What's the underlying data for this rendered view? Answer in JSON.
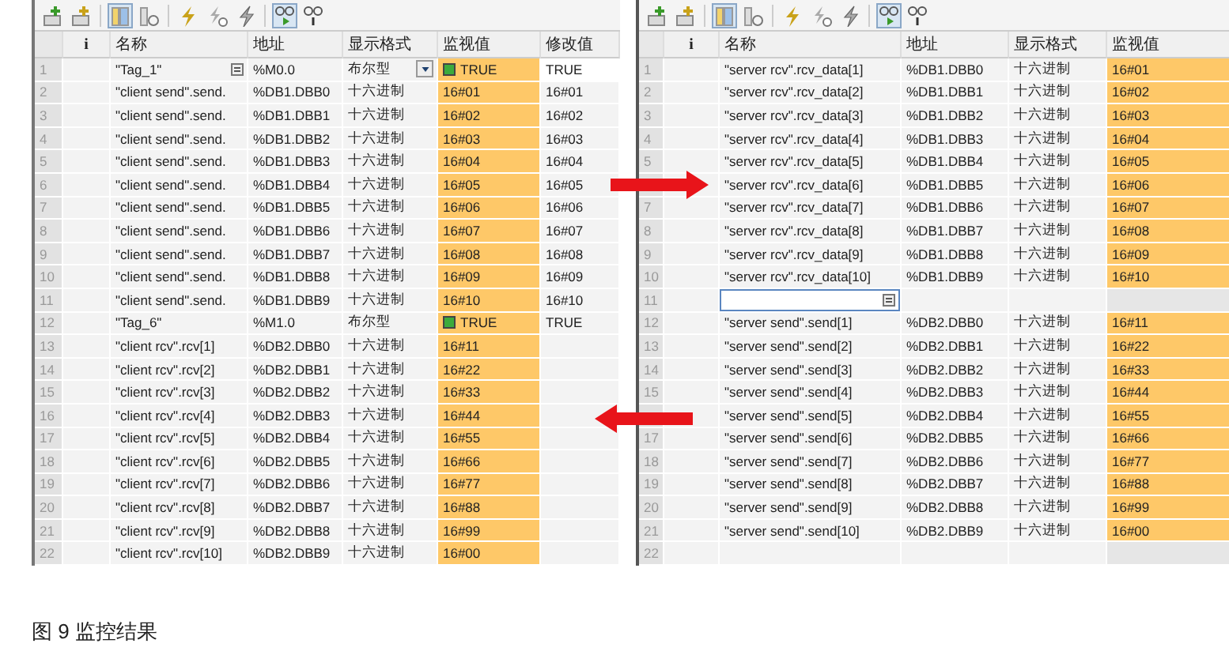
{
  "panels": [
    {
      "toolbar": [
        {
          "kind": "insert-row",
          "selected": false
        },
        {
          "kind": "add-row",
          "selected": false
        },
        {
          "kind": "columns",
          "selected": true
        },
        {
          "kind": "column-toggle",
          "selected": false
        },
        {
          "kind": "force",
          "selected": false
        },
        {
          "kind": "force-timer",
          "selected": false
        },
        {
          "kind": "force-all",
          "selected": false
        },
        {
          "kind": "monitor",
          "selected": true
        },
        {
          "kind": "monitor-once",
          "selected": false
        }
      ],
      "columns": [
        "i",
        "名称",
        "地址",
        "显示格式",
        "监视值",
        "修改值"
      ],
      "rows": [
        {
          "number": "1",
          "kind": "bool",
          "editing": true,
          "name": "\"Tag_1\"",
          "address": "%M0.0",
          "format": "布尔型",
          "monitor": "TRUE",
          "modify": "TRUE"
        },
        {
          "number": "2",
          "kind": "hex",
          "editing": false,
          "name": "\"client send\".send.",
          "address": "%DB1.DBB0",
          "format": "十六进制",
          "monitor": "16#01",
          "modify": "16#01"
        },
        {
          "number": "3",
          "kind": "hex",
          "editing": false,
          "name": "\"client send\".send.",
          "address": "%DB1.DBB1",
          "format": "十六进制",
          "monitor": "16#02",
          "modify": "16#02"
        },
        {
          "number": "4",
          "kind": "hex",
          "editing": false,
          "name": "\"client send\".send.",
          "address": "%DB1.DBB2",
          "format": "十六进制",
          "monitor": "16#03",
          "modify": "16#03"
        },
        {
          "number": "5",
          "kind": "hex",
          "editing": false,
          "name": "\"client send\".send.",
          "address": "%DB1.DBB3",
          "format": "十六进制",
          "monitor": "16#04",
          "modify": "16#04"
        },
        {
          "number": "6",
          "kind": "hex",
          "editing": false,
          "name": "\"client send\".send.",
          "address": "%DB1.DBB4",
          "format": "十六进制",
          "monitor": "16#05",
          "modify": "16#05"
        },
        {
          "number": "7",
          "kind": "hex",
          "editing": false,
          "name": "\"client send\".send.",
          "address": "%DB1.DBB5",
          "format": "十六进制",
          "monitor": "16#06",
          "modify": "16#06"
        },
        {
          "number": "8",
          "kind": "hex",
          "editing": false,
          "name": "\"client send\".send.",
          "address": "%DB1.DBB6",
          "format": "十六进制",
          "monitor": "16#07",
          "modify": "16#07"
        },
        {
          "number": "9",
          "kind": "hex",
          "editing": false,
          "name": "\"client send\".send.",
          "address": "%DB1.DBB7",
          "format": "十六进制",
          "monitor": "16#08",
          "modify": "16#08"
        },
        {
          "number": "10",
          "kind": "hex",
          "editing": false,
          "name": "\"client send\".send.",
          "address": "%DB1.DBB8",
          "format": "十六进制",
          "monitor": "16#09",
          "modify": "16#09"
        },
        {
          "number": "11",
          "kind": "hex",
          "editing": false,
          "name": "\"client send\".send.",
          "address": "%DB1.DBB9",
          "format": "十六进制",
          "monitor": "16#10",
          "modify": "16#10"
        },
        {
          "number": "12",
          "kind": "bool",
          "editing": false,
          "name": "\"Tag_6\"",
          "address": "%M1.0",
          "format": "布尔型",
          "monitor": "TRUE",
          "modify": "TRUE"
        },
        {
          "number": "13",
          "kind": "hex",
          "editing": false,
          "name": "\"client rcv\".rcv[1]",
          "address": "%DB2.DBB0",
          "format": "十六进制",
          "monitor": "16#11"
        },
        {
          "number": "14",
          "kind": "hex",
          "editing": false,
          "name": "\"client rcv\".rcv[2]",
          "address": "%DB2.DBB1",
          "format": "十六进制",
          "monitor": "16#22"
        },
        {
          "number": "15",
          "kind": "hex",
          "editing": false,
          "name": "\"client rcv\".rcv[3]",
          "address": "%DB2.DBB2",
          "format": "十六进制",
          "monitor": "16#33"
        },
        {
          "number": "16",
          "kind": "hex",
          "editing": false,
          "name": "\"client rcv\".rcv[4]",
          "address": "%DB2.DBB3",
          "format": "十六进制",
          "monitor": "16#44"
        },
        {
          "number": "17",
          "kind": "hex",
          "editing": false,
          "name": "\"client rcv\".rcv[5]",
          "address": "%DB2.DBB4",
          "format": "十六进制",
          "monitor": "16#55"
        },
        {
          "number": "18",
          "kind": "hex",
          "editing": false,
          "name": "\"client rcv\".rcv[6]",
          "address": "%DB2.DBB5",
          "format": "十六进制",
          "monitor": "16#66"
        },
        {
          "number": "19",
          "kind": "hex",
          "editing": false,
          "name": "\"client rcv\".rcv[7]",
          "address": "%DB2.DBB6",
          "format": "十六进制",
          "monitor": "16#77"
        },
        {
          "number": "20",
          "kind": "hex",
          "editing": false,
          "name": "\"client rcv\".rcv[8]",
          "address": "%DB2.DBB7",
          "format": "十六进制",
          "monitor": "16#88"
        },
        {
          "number": "21",
          "kind": "hex",
          "editing": false,
          "name": "\"client rcv\".rcv[9]",
          "address": "%DB2.DBB8",
          "format": "十六进制",
          "monitor": "16#99"
        },
        {
          "number": "22",
          "kind": "hex",
          "editing": false,
          "name": "\"client rcv\".rcv[10]",
          "address": "%DB2.DBB9",
          "format": "十六进制",
          "monitor": "16#00"
        }
      ]
    },
    {
      "toolbar": [
        {
          "kind": "insert-row",
          "selected": false
        },
        {
          "kind": "add-row",
          "selected": false
        },
        {
          "kind": "columns",
          "selected": true
        },
        {
          "kind": "column-toggle",
          "selected": false
        },
        {
          "kind": "force",
          "selected": false
        },
        {
          "kind": "force-timer",
          "selected": false
        },
        {
          "kind": "force-all",
          "selected": false
        },
        {
          "kind": "monitor",
          "selected": true
        },
        {
          "kind": "monitor-once",
          "selected": false
        }
      ],
      "columns": [
        "i",
        "名称",
        "地址",
        "显示格式",
        "监视值"
      ],
      "rows": [
        {
          "number": "1",
          "kind": "hex",
          "editing": false,
          "name": "\"server rcv\".rcv_data[1]",
          "address": "%DB1.DBB0",
          "format": "十六进制",
          "monitor": "16#01"
        },
        {
          "number": "2",
          "kind": "hex",
          "editing": false,
          "name": "\"server rcv\".rcv_data[2]",
          "address": "%DB1.DBB1",
          "format": "十六进制",
          "monitor": "16#02"
        },
        {
          "number": "3",
          "kind": "hex",
          "editing": false,
          "name": "\"server rcv\".rcv_data[3]",
          "address": "%DB1.DBB2",
          "format": "十六进制",
          "monitor": "16#03"
        },
        {
          "number": "4",
          "kind": "hex",
          "editing": false,
          "name": "\"server rcv\".rcv_data[4]",
          "address": "%DB1.DBB3",
          "format": "十六进制",
          "monitor": "16#04"
        },
        {
          "number": "5",
          "kind": "hex",
          "editing": false,
          "name": "\"server rcv\".rcv_data[5]",
          "address": "%DB1.DBB4",
          "format": "十六进制",
          "monitor": "16#05"
        },
        {
          "kind": "hex",
          "editing": false,
          "name": "\"server rcv\".rcv_data[6]",
          "address": "%DB1.DBB5",
          "format": "十六进制",
          "monitor": "16#06"
        },
        {
          "number": "7",
          "kind": "hex",
          "editing": false,
          "name": "\"server rcv\".rcv_data[7]",
          "address": "%DB1.DBB6",
          "format": "十六进制",
          "monitor": "16#07"
        },
        {
          "number": "8",
          "kind": "hex",
          "editing": false,
          "name": "\"server rcv\".rcv_data[8]",
          "address": "%DB1.DBB7",
          "format": "十六进制",
          "monitor": "16#08"
        },
        {
          "number": "9",
          "kind": "hex",
          "editing": false,
          "name": "\"server rcv\".rcv_data[9]",
          "address": "%DB1.DBB8",
          "format": "十六进制",
          "monitor": "16#09"
        },
        {
          "number": "10",
          "kind": "hex",
          "editing": false,
          "name": "\"server rcv\".rcv_data[10]",
          "address": "%DB1.DBB9",
          "format": "十六进制",
          "monitor": "16#10"
        },
        {
          "number": "11",
          "kind": "blank",
          "editing": true
        },
        {
          "number": "12",
          "kind": "hex",
          "editing": false,
          "name": "\"server send\".send[1]",
          "address": "%DB2.DBB0",
          "format": "十六进制",
          "monitor": "16#11"
        },
        {
          "number": "13",
          "kind": "hex",
          "editing": false,
          "name": "\"server send\".send[2]",
          "address": "%DB2.DBB1",
          "format": "十六进制",
          "monitor": "16#22"
        },
        {
          "number": "14",
          "kind": "hex",
          "editing": false,
          "name": "\"server send\".send[3]",
          "address": "%DB2.DBB2",
          "format": "十六进制",
          "monitor": "16#33"
        },
        {
          "number": "15",
          "kind": "hex",
          "editing": false,
          "name": "\"server send\".send[4]",
          "address": "%DB2.DBB3",
          "format": "十六进制",
          "monitor": "16#44"
        },
        {
          "kind": "hex",
          "editing": false,
          "name": "\"server send\".send[5]",
          "address": "%DB2.DBB4",
          "format": "十六进制",
          "monitor": "16#55"
        },
        {
          "number": "17",
          "kind": "hex",
          "editing": false,
          "name": "\"server send\".send[6]",
          "address": "%DB2.DBB5",
          "format": "十六进制",
          "monitor": "16#66"
        },
        {
          "number": "18",
          "kind": "hex",
          "editing": false,
          "name": "\"server send\".send[7]",
          "address": "%DB2.DBB6",
          "format": "十六进制",
          "monitor": "16#77"
        },
        {
          "number": "19",
          "kind": "hex",
          "editing": false,
          "name": "\"server send\".send[8]",
          "address": "%DB2.DBB7",
          "format": "十六进制",
          "monitor": "16#88"
        },
        {
          "number": "20",
          "kind": "hex",
          "editing": false,
          "name": "\"server send\".send[9]",
          "address": "%DB2.DBB8",
          "format": "十六进制",
          "monitor": "16#99"
        },
        {
          "number": "21",
          "kind": "hex",
          "editing": false,
          "name": "\"server send\".send[10]",
          "address": "%DB2.DBB9",
          "format": "十六进制",
          "monitor": "16#00"
        },
        {
          "number": "22",
          "kind": "blank",
          "editing": false
        }
      ]
    }
  ],
  "annotations": [
    {
      "kind": "right-arrow"
    },
    {
      "kind": "left-arrow"
    }
  ],
  "caption": "图 9 监控结果"
}
